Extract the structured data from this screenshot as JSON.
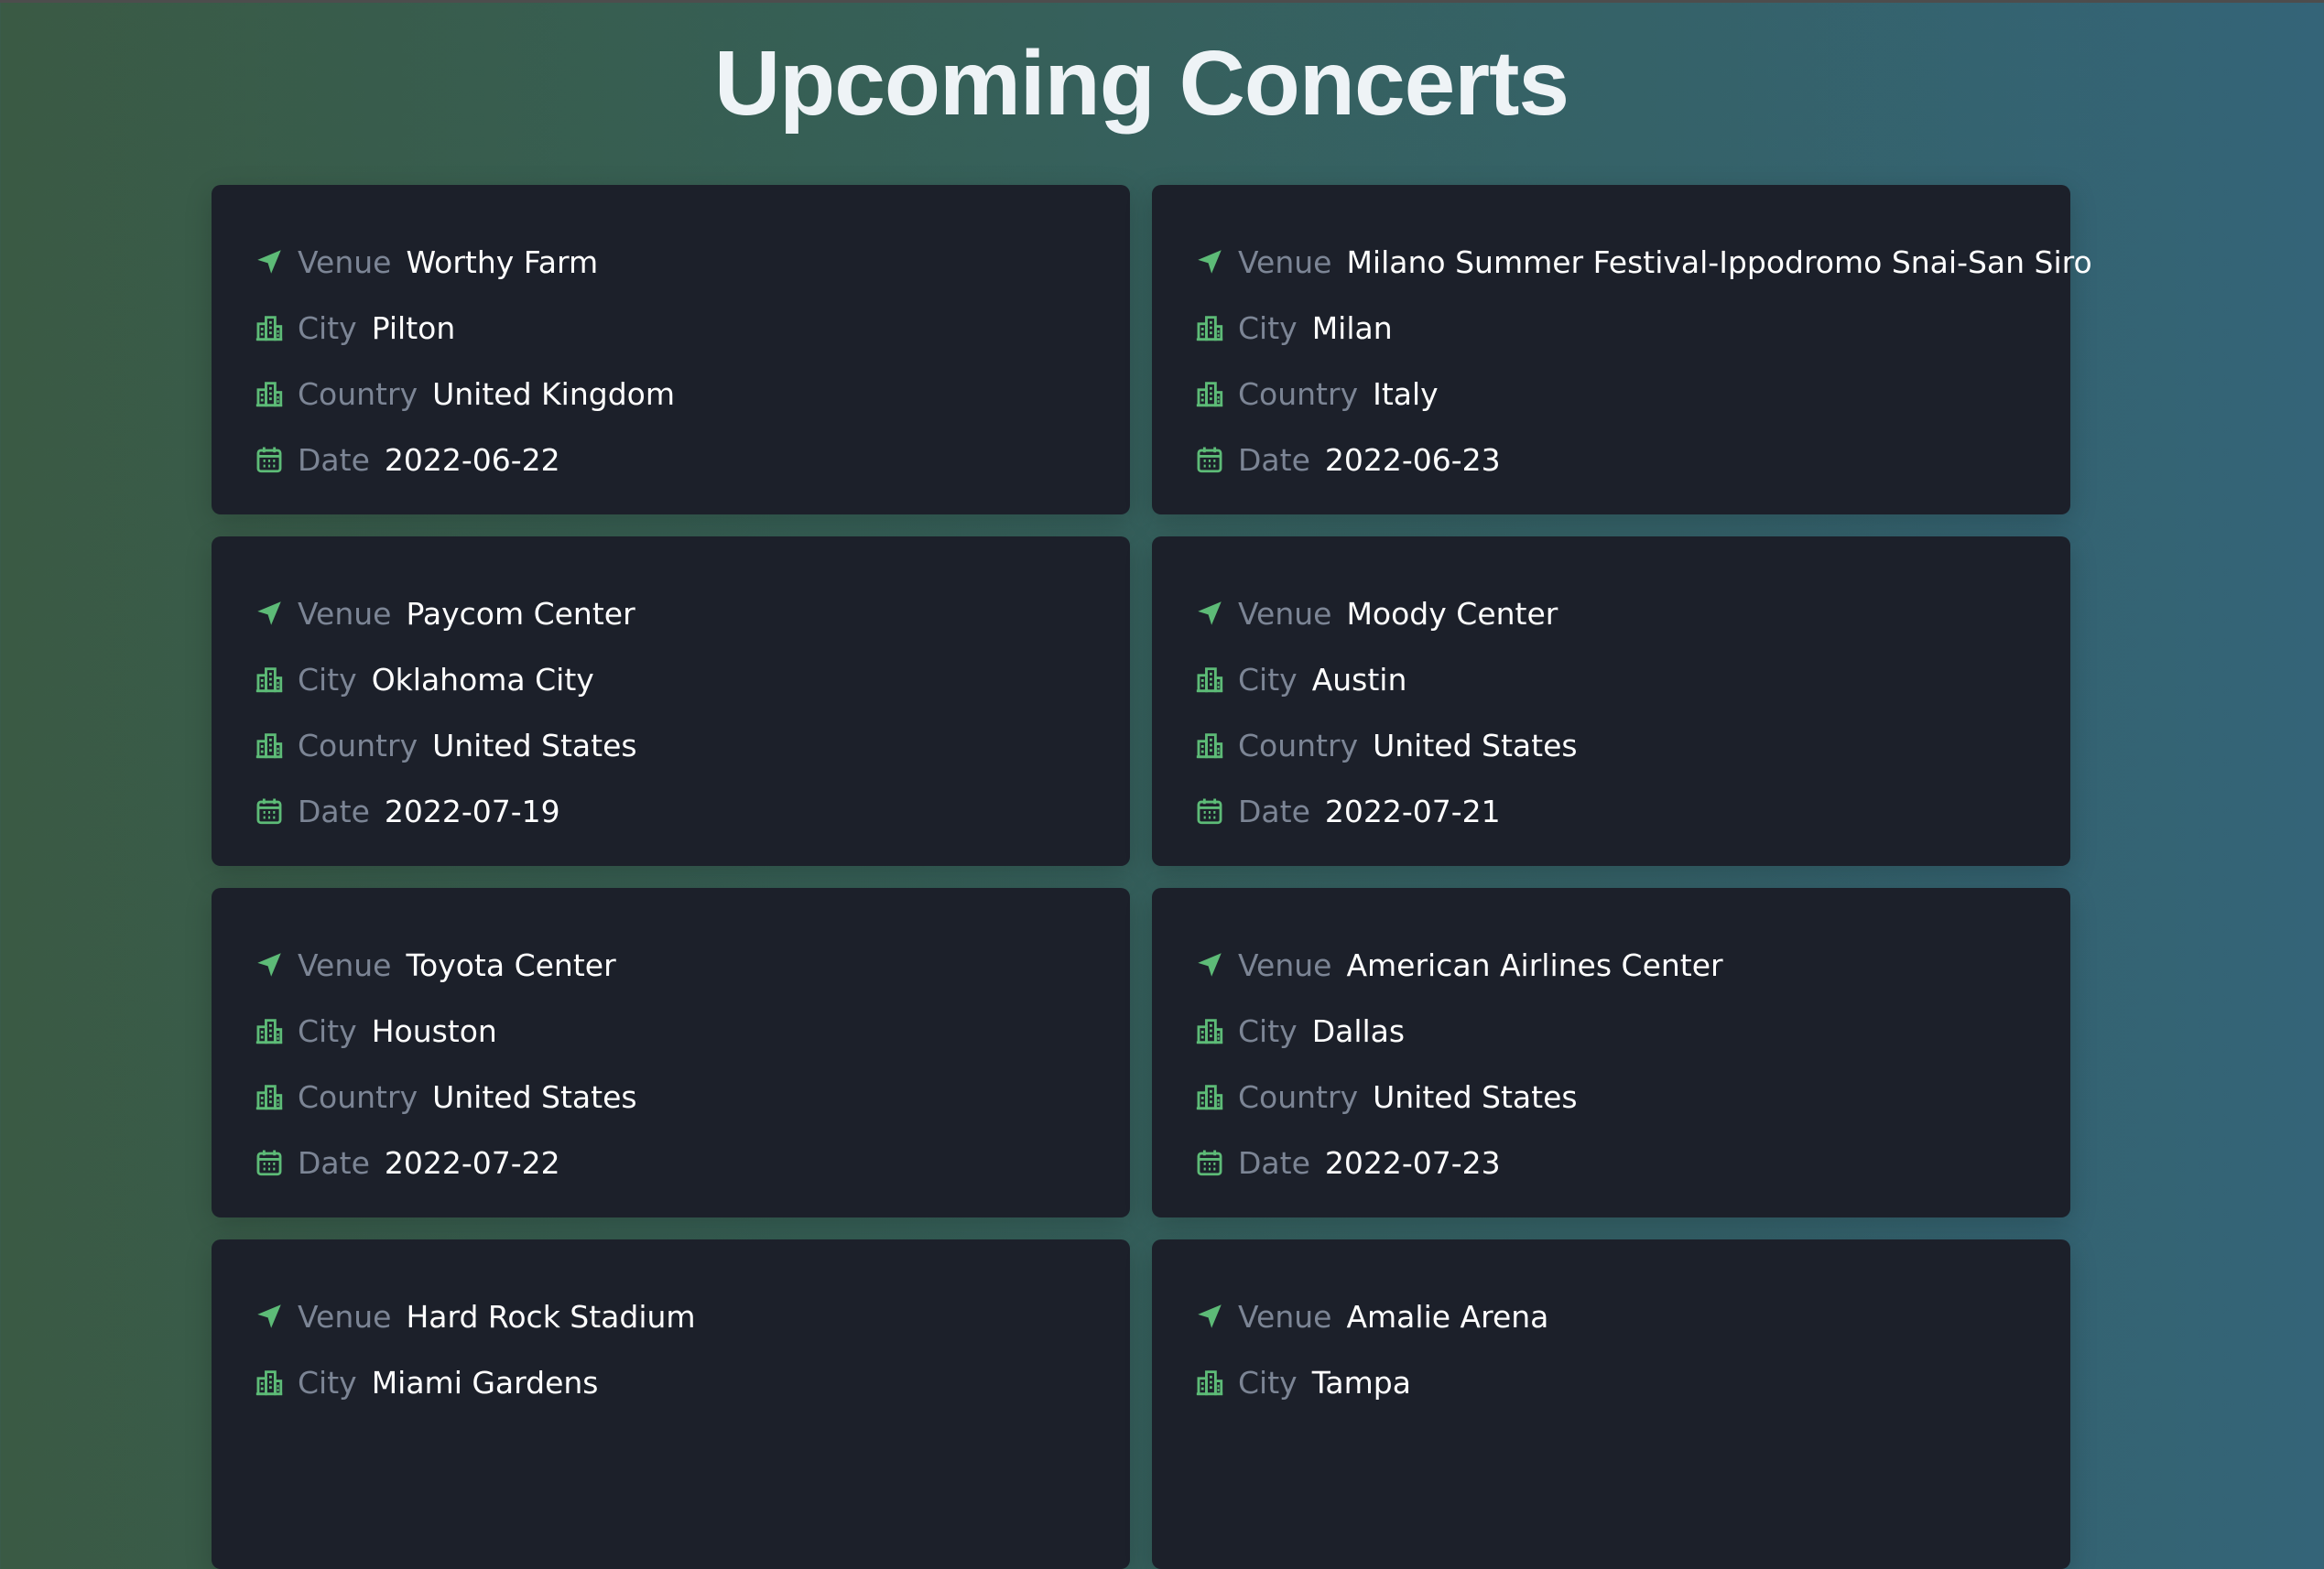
{
  "page": {
    "title": "Upcoming Concerts",
    "accent_color": "#5dbb77"
  },
  "labels": {
    "venue": "Venue",
    "city": "City",
    "country": "Country",
    "date": "Date"
  },
  "icons": {
    "venue": "location-arrow-icon",
    "city": "city-buildings-icon",
    "country": "city-buildings-icon",
    "date": "calendar-icon"
  },
  "concerts": [
    {
      "venue": "Worthy Farm",
      "city": "Pilton",
      "country": "United Kingdom",
      "date": "2022-06-22"
    },
    {
      "venue": "Milano Summer Festival-Ippodromo Snai-San Siro",
      "city": "Milan",
      "country": "Italy",
      "date": "2022-06-23"
    },
    {
      "venue": "Paycom Center",
      "city": "Oklahoma City",
      "country": "United States",
      "date": "2022-07-19"
    },
    {
      "venue": "Moody Center",
      "city": "Austin",
      "country": "United States",
      "date": "2022-07-21"
    },
    {
      "venue": "Toyota Center",
      "city": "Houston",
      "country": "United States",
      "date": "2022-07-22"
    },
    {
      "venue": "American Airlines Center",
      "city": "Dallas",
      "country": "United States",
      "date": "2022-07-23"
    },
    {
      "venue": "Hard Rock Stadium",
      "city": "Miami Gardens"
    },
    {
      "venue": "Amalie Arena",
      "city": "Tampa"
    }
  ]
}
